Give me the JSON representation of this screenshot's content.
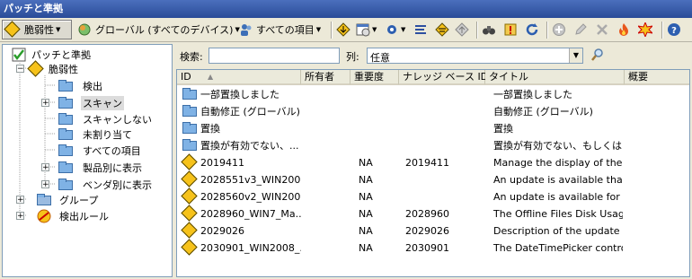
{
  "window": {
    "title": "パッチと準拠"
  },
  "toolbar": {
    "vuln_label": "脆弱性",
    "global_label": "グローバル (すべてのデバイス)",
    "all_items_label": "すべての項目"
  },
  "tree": {
    "root": "パッチと準拠",
    "vulnerability": "脆弱性",
    "detected": "検出",
    "scan": "スキャン",
    "no_scan": "スキャンしない",
    "unassigned": "未割り当て",
    "all_items": "すべての項目",
    "by_product": "製品別に表示",
    "by_vendor": "ベンダ別に表示",
    "group": "グループ",
    "detection_rules": "検出ルール"
  },
  "filters": {
    "search_label": "検索:",
    "search_value": "",
    "column_label": "列:",
    "column_value": "任意"
  },
  "columns": [
    "ID",
    "所有者",
    "重要度",
    "ナレッジ ベース ID",
    "タイトル",
    "概要"
  ],
  "rows": [
    {
      "icon": "folder",
      "id": "一部置換しました",
      "owner": "",
      "severity": "",
      "kb": "",
      "title": "一部置換しました"
    },
    {
      "icon": "folder",
      "id": "自動修正 (グローバル)",
      "owner": "",
      "severity": "",
      "kb": "",
      "title": "自動修正 (グローバル)"
    },
    {
      "icon": "folder",
      "id": "置換",
      "owner": "",
      "severity": "",
      "kb": "",
      "title": "置換"
    },
    {
      "icon": "folder",
      "id": "置換が有効でない、...",
      "owner": "",
      "severity": "",
      "kb": "",
      "title": "置換が有効でない、もしくは..."
    },
    {
      "icon": "vuln",
      "id": "2019411",
      "owner": "",
      "severity": "NA",
      "kb": "2019411",
      "title": "Manage the display of the B..."
    },
    {
      "icon": "vuln",
      "id": "2028551v3_WIN200...",
      "owner": "",
      "severity": "NA",
      "kb": "",
      "title": "An update is available that ..."
    },
    {
      "icon": "vuln",
      "id": "2028560v2_WIN200...",
      "owner": "",
      "severity": "NA",
      "kb": "",
      "title": "An update is available for ..."
    },
    {
      "icon": "vuln",
      "id": "2028960_WIN7_Ma...",
      "owner": "",
      "severity": "NA",
      "kb": "2028960",
      "title": "The Offline Files Disk Usag..."
    },
    {
      "icon": "vuln",
      "id": "2029026",
      "owner": "",
      "severity": "NA",
      "kb": "2029026",
      "title": "Description of the update p..."
    },
    {
      "icon": "vuln",
      "id": "2030901_WIN2008_...",
      "owner": "",
      "severity": "NA",
      "kb": "2030901",
      "title": "The DateTimePicker contro..."
    }
  ]
}
